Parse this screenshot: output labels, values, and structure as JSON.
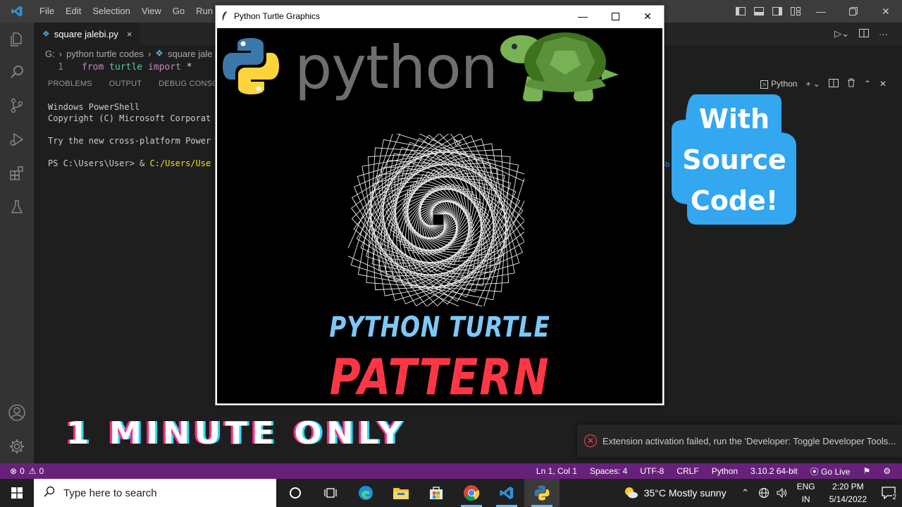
{
  "vscode": {
    "menu": [
      "File",
      "Edit",
      "Selection",
      "View",
      "Go",
      "Run",
      "T"
    ],
    "tab_label": "square jalebi.py",
    "breadcrumb": [
      "G:",
      "python turtle codes",
      "square jale"
    ],
    "code_line_number": "1",
    "code_line": {
      "kw1": "from",
      "mod": "turtle",
      "kw2": "import",
      "op": "*"
    },
    "panel_tabs": [
      "PROBLEMS",
      "OUTPUT",
      "DEBUG CONSOLE"
    ],
    "terminal_name": "Python",
    "terminal_lines": [
      "Windows PowerShell",
      "Copyright (C) Microsoft Corporat",
      "",
      "Try the new cross-platform Power",
      ""
    ],
    "prompt": "PS C:\\Users\\User> & ",
    "prompt_path": "C:/Users/Use",
    "scroll_text": "eb"
  },
  "turtle_window": {
    "title": "Python Turtle Graphics",
    "python_word": "python",
    "line1": "PYTHON TURTLE",
    "line2": "PATTERN"
  },
  "badge": {
    "lines": [
      "With",
      "Source",
      "Code!"
    ]
  },
  "overlay": {
    "one_minute": "1 MINUTE ONLY"
  },
  "notification": {
    "text": "Extension activation failed, run the 'Developer: Toggle Developer Tools..."
  },
  "statusbar": {
    "errors": "0",
    "warnings": "0",
    "position": "Ln 1, Col 1",
    "spaces": "Spaces: 4",
    "encoding": "UTF-8",
    "eol": "CRLF",
    "language": "Python",
    "interpreter": "3.10.2 64-bit",
    "golive": "Go Live"
  },
  "taskbar": {
    "search_placeholder": "Type here to search",
    "weather": "35°C  Mostly sunny",
    "lang1": "ENG",
    "lang2": "IN",
    "time": "2:20 PM",
    "date": "5/14/2022",
    "notif_count": "2"
  },
  "colors": {
    "statusbar": "#68217a",
    "badge": "#33a7f0",
    "pattern_title": "#7ec8f7",
    "pattern": "#ff3645"
  }
}
